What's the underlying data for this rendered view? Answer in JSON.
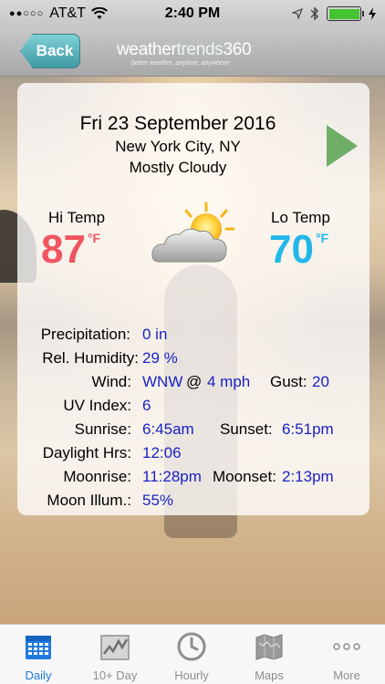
{
  "status_bar": {
    "carrier": "AT&T",
    "signal": "●●○○○",
    "time": "2:40 PM"
  },
  "nav": {
    "back_label": "Back",
    "logo_text_a": "weather",
    "logo_text_b": "trends",
    "logo_text_c": "360",
    "logo_tagline": "better weather, anytime, anywhere"
  },
  "forecast": {
    "date": "Fri 23 September 2016",
    "location": "New York City, NY",
    "condition": "Mostly Cloudy",
    "hi_label": "Hi Temp",
    "lo_label": "Lo Temp",
    "hi_value": "87",
    "lo_value": "70",
    "unit": "°F",
    "weather_icon": "partly-cloudy-icon"
  },
  "details": {
    "precipitation_label": "Precipitation:",
    "precipitation_value": "0 in",
    "humidity_label": "Rel. Humidity:",
    "humidity_value": "29 %",
    "wind_label": "Wind:",
    "wind_dir": "WNW",
    "wind_at": "@",
    "wind_speed": "4 mph",
    "gust_label": "Gust:",
    "gust_value": "20",
    "uv_label": "UV Index:",
    "uv_value": "6",
    "sunrise_label": "Sunrise:",
    "sunrise_value": "6:45am",
    "sunset_label": "Sunset:",
    "sunset_value": "6:51pm",
    "daylight_label": "Daylight Hrs:",
    "daylight_value": "12:06",
    "moonrise_label": "Moonrise:",
    "moonrise_value": "11:28pm",
    "moonset_label": "Moonset:",
    "moonset_value": "2:13pm",
    "moon_illum_label": "Moon Illum.:",
    "moon_illum_value": "55%"
  },
  "tabs": [
    {
      "label": "Daily",
      "icon": "calendar-icon",
      "active": true
    },
    {
      "label": "10+ Day",
      "icon": "trend-chart-icon",
      "active": false
    },
    {
      "label": "Hourly",
      "icon": "clock-icon",
      "active": false
    },
    {
      "label": "Maps",
      "icon": "map-icon",
      "active": false
    },
    {
      "label": "More",
      "icon": "more-dots-icon",
      "active": false
    }
  ],
  "colors": {
    "hi_temp": "#f05560",
    "lo_temp": "#22b7e8",
    "value_text": "#1a22c4",
    "active_tab": "#1f7ae0",
    "battery": "#44c430"
  }
}
